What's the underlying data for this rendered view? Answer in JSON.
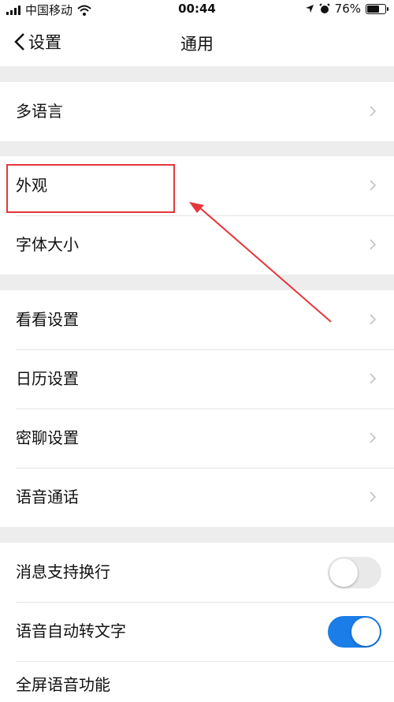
{
  "status_bar": {
    "carrier": "中国移动",
    "time": "00:44",
    "battery": "76%",
    "battery_level": 0.76,
    "icons": [
      "signal-icon",
      "wifi-icon",
      "location-icon",
      "alarm-icon",
      "battery-icon"
    ]
  },
  "nav": {
    "back_label": "设置",
    "title": "通用"
  },
  "groups": [
    {
      "rows": [
        {
          "label": "多语言",
          "type": "chevron"
        }
      ]
    },
    {
      "rows": [
        {
          "label": "外观",
          "type": "chevron"
        },
        {
          "label": "字体大小",
          "type": "chevron"
        }
      ]
    },
    {
      "rows": [
        {
          "label": "看看设置",
          "type": "chevron"
        },
        {
          "label": "日历设置",
          "type": "chevron"
        },
        {
          "label": "密聊设置",
          "type": "chevron"
        },
        {
          "label": "语音通话",
          "type": "chevron"
        }
      ]
    },
    {
      "rows": [
        {
          "label": "消息支持换行",
          "type": "toggle",
          "on": false
        },
        {
          "label": "语音自动转文字",
          "type": "toggle",
          "on": true
        },
        {
          "label": "全屏语音功能",
          "type": "chevron_hidden"
        }
      ]
    }
  ],
  "colors": {
    "accent": "#1a7de8",
    "annotation": "#e5363b",
    "background": "#ededed"
  }
}
